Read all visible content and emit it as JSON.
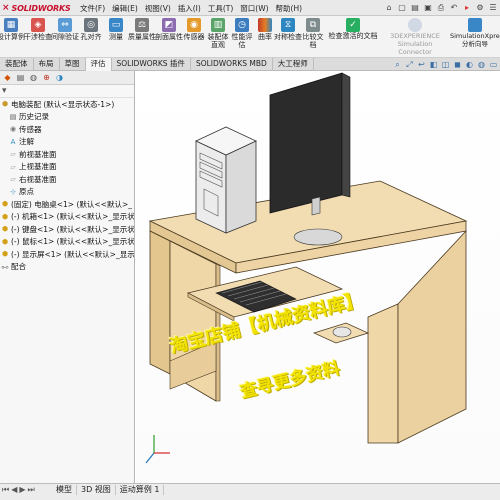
{
  "app": {
    "logo_text": "SOLIDWORKS",
    "menu": [
      "文件(F)",
      "编辑(E)",
      "视图(V)",
      "插入(I)",
      "工具(T)",
      "窗口(W)",
      "帮助(H)"
    ]
  },
  "ribbon": {
    "buttons": [
      {
        "label": "设计算例",
        "color": "#4a7fbf"
      },
      {
        "label": "干涉检查",
        "color": "#d9534f"
      },
      {
        "label": "间隙验证",
        "color": "#5b9bd5"
      },
      {
        "label": "孔对齐",
        "color": "#6c757d"
      },
      {
        "label": "测量",
        "color": "#3a87c8"
      },
      {
        "label": "质量属性",
        "color": "#7a7a7a"
      },
      {
        "label": "剖面属性",
        "color": "#8c6bb1"
      },
      {
        "label": "传感器",
        "color": "#e39a2b"
      },
      {
        "label": "装配体直观",
        "color": "#5aa469"
      },
      {
        "label": "性能评估",
        "color": "#3c7dbf"
      },
      {
        "label": "曲率",
        "color": "#c0392b"
      },
      {
        "label": "对称检查",
        "color": "#2e86c1"
      },
      {
        "label": "比较文档",
        "color": "#7f8c8d"
      },
      {
        "label": "检查激活的文档",
        "color": "#27ae60"
      }
    ],
    "experience": "3DEXPERIENCE Simulation Connector",
    "simxpress": "SimulationXpress 分析向导"
  },
  "tabs": [
    "装配体",
    "布局",
    "草图",
    "评估",
    "SOLIDWORKS 插件",
    "SOLIDWORKS MBD",
    "大工程师"
  ],
  "active_tab_index": 3,
  "tree": {
    "root": "电脑装配 (默认<显示状态-1>)",
    "items": [
      {
        "label": "历史记录",
        "icon": "history-icon",
        "indent": 1
      },
      {
        "label": "传感器",
        "icon": "sensor-icon",
        "indent": 1
      },
      {
        "label": "注解",
        "icon": "annotation-icon",
        "indent": 1
      },
      {
        "label": "前视基准面",
        "icon": "plane-icon",
        "indent": 1
      },
      {
        "label": "上视基准面",
        "icon": "plane-icon",
        "indent": 1
      },
      {
        "label": "右视基准面",
        "icon": "plane-icon",
        "indent": 1
      },
      {
        "label": "原点",
        "icon": "origin-icon",
        "indent": 1
      },
      {
        "label": "(固定) 电脑桌<1> (默认<<默认>_",
        "icon": "part-icon",
        "indent": 1
      },
      {
        "label": "(-) 机箱<1> (默认<<默认>_显示状",
        "icon": "part-icon",
        "indent": 1
      },
      {
        "label": "(-) 键盘<1> (默认<<默认>_显示状",
        "icon": "part-icon",
        "indent": 1
      },
      {
        "label": "(-) 鼠标<1> (默认<<默认>_显示状",
        "icon": "part-icon",
        "indent": 1
      },
      {
        "label": "(-) 显示屏<1> (默认<<默认>_显示",
        "icon": "part-icon",
        "indent": 1
      },
      {
        "label": "配合",
        "icon": "mate-icon",
        "indent": 1
      }
    ]
  },
  "watermark": {
    "line1": "淘宝店铺【机械资料库】",
    "line2": "查寻更多资料"
  },
  "bottom": {
    "tabs": [
      "模型",
      "3D 视图",
      "运动算例 1"
    ]
  },
  "colors": {
    "wood": "#f0d9b0",
    "wood_dark": "#d9bd8b",
    "case": "#ececec",
    "monitor": "#2a2a2a",
    "brand": "#c8102e",
    "watermark": "#f2e300"
  }
}
